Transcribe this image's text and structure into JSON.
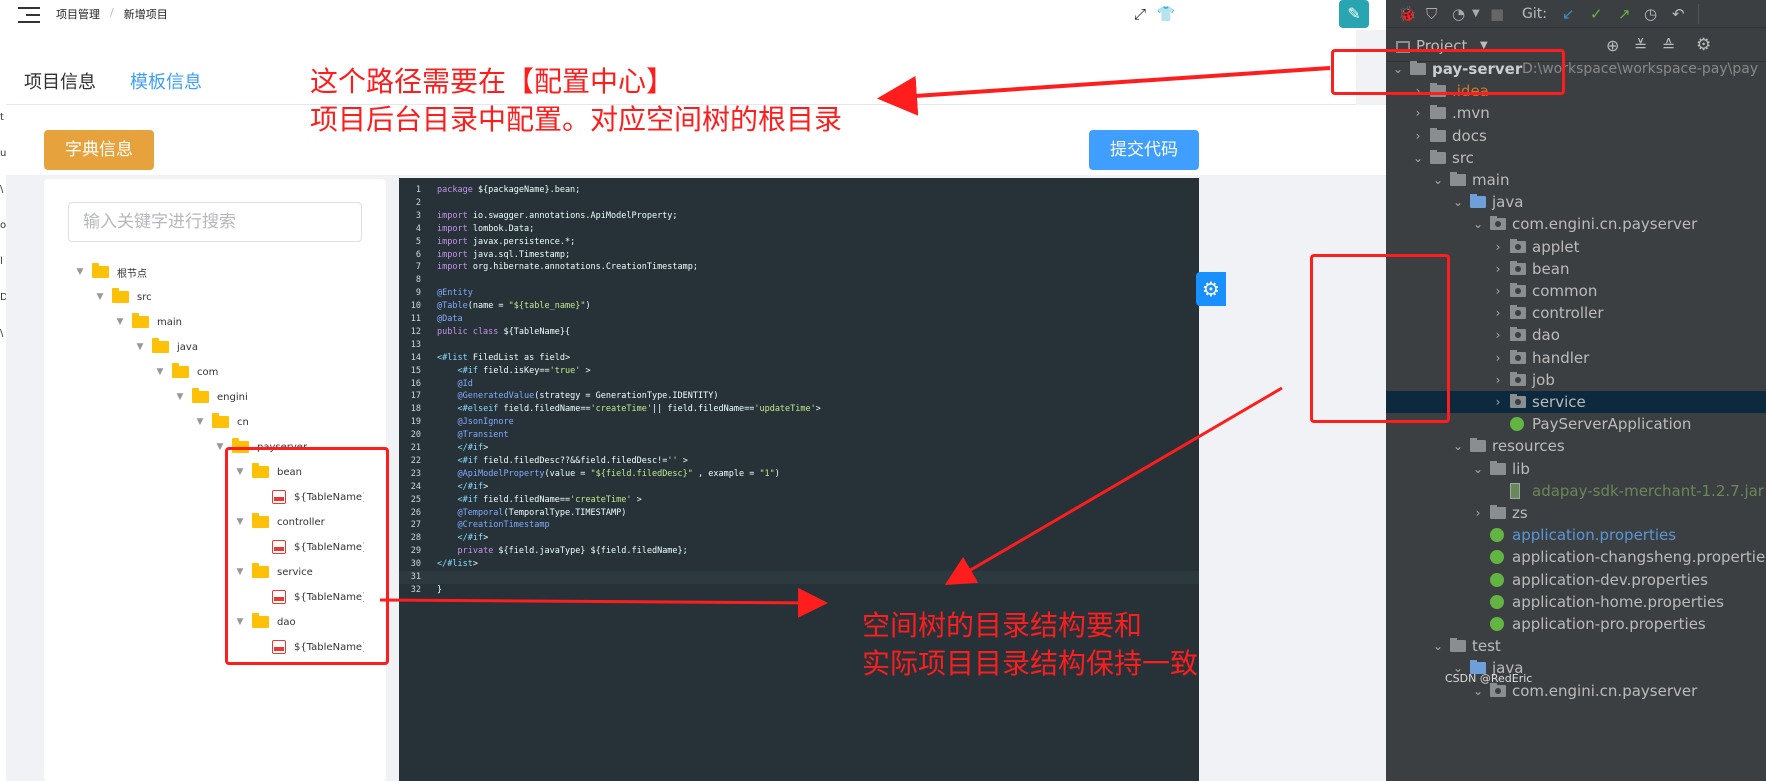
{
  "topbar": {
    "breadcrumb": [
      "项目管理",
      "新增项目"
    ],
    "breadcrumb_sep": "/",
    "icons": [
      "fullscreen-icon",
      "skin-icon",
      "avatar-icon"
    ]
  },
  "left_strip_chars": [
    "t",
    "u",
    "\\",
    "o",
    "l",
    "D",
    "\\"
  ],
  "tabs": [
    {
      "label": "项目信息",
      "active": false
    },
    {
      "label": "模板信息",
      "active": true
    }
  ],
  "buttons": {
    "dict": "字典信息",
    "submit": "提交代码"
  },
  "tree": {
    "search_placeholder": "输入关键字进行搜索",
    "nodes": [
      {
        "label": "根节点",
        "kind": "folder"
      },
      {
        "label": "src",
        "kind": "folder"
      },
      {
        "label": "main",
        "kind": "folder"
      },
      {
        "label": "java",
        "kind": "folder"
      },
      {
        "label": "com",
        "kind": "folder"
      },
      {
        "label": "engini",
        "kind": "folder"
      },
      {
        "label": "cn",
        "kind": "folder"
      },
      {
        "label": "payserver",
        "kind": "folder"
      },
      {
        "label": "bean",
        "kind": "folder"
      },
      {
        "label": "${TableName}.jav",
        "kind": "file"
      },
      {
        "label": "controller",
        "kind": "folder"
      },
      {
        "label": "${TableName}Co",
        "kind": "file"
      },
      {
        "label": "service",
        "kind": "folder"
      },
      {
        "label": "${TableName}Se",
        "kind": "file"
      },
      {
        "label": "dao",
        "kind": "folder"
      },
      {
        "label": "${TableName}Da",
        "kind": "file"
      }
    ]
  },
  "code_lines": [
    "package ${packageName}.bean;",
    "",
    "import io.swagger.annotations.ApiModelProperty;",
    "import lombok.Data;",
    "import javax.persistence.*;",
    "import java.sql.Timestamp;",
    "import org.hibernate.annotations.CreationTimestamp;",
    "",
    "@Entity",
    "@Table(name = \"${table_name}\")",
    "@Data",
    "public class ${TableName}{",
    "",
    "<#list FiledList as field>",
    "    <#if field.isKey=='true' >",
    "    @Id",
    "    @GeneratedValue(strategy = GenerationType.IDENTITY)",
    "    <#elseif field.filedName=='createTime'|| field.filedName=='updateTime'>",
    "    @JsonIgnore",
    "    @Transient",
    "    </#if>",
    "    <#if field.filedDesc??&&field.filedDesc!='' >",
    "    @ApiModelProperty(value = \"${field.filedDesc}\" , example = \"1\")",
    "    </#if>",
    "    <#if field.filedName=='createTime' >",
    "    @Temporal(TemporalType.TIMESTAMP)",
    "    @CreationTimestamp",
    "    </#if>",
    "    private ${field.javaType} ${field.filedName};",
    "</#list>",
    "",
    "}"
  ],
  "annotations": {
    "top_line1": "这个路径需要在【配置中心】",
    "top_line2": "项目后台目录中配置。对应空间树的根目录",
    "bottom_line1": "空间树的目录结构要和",
    "bottom_line2": "实际项目目录结构保持一致"
  },
  "ide": {
    "toolbar_git_label": "Git:",
    "panel_title": "Project",
    "rows": [
      {
        "label": "pay-server",
        "extra": "D:\\workspace\\workspace-pay\\pay",
        "icon": "folder",
        "chev": "v",
        "depth": 0,
        "style": "bold"
      },
      {
        "label": ".idea",
        "icon": "folder",
        "chev": ">",
        "depth": 1,
        "style": "orange"
      },
      {
        "label": ".mvn",
        "icon": "folder",
        "chev": ">",
        "depth": 1,
        "style": ""
      },
      {
        "label": "docs",
        "icon": "folder",
        "chev": ">",
        "depth": 1,
        "style": ""
      },
      {
        "label": "src",
        "icon": "folder",
        "chev": "v",
        "depth": 1,
        "style": ""
      },
      {
        "label": "main",
        "icon": "folder",
        "chev": "v",
        "depth": 2,
        "style": ""
      },
      {
        "label": "java",
        "icon": "folder-blue",
        "chev": "v",
        "depth": 3,
        "style": ""
      },
      {
        "label": "com.engini.cn.payserver",
        "icon": "package",
        "chev": "v",
        "depth": 4,
        "style": ""
      },
      {
        "label": "applet",
        "icon": "package",
        "chev": ">",
        "depth": 5,
        "style": ""
      },
      {
        "label": "bean",
        "icon": "package",
        "chev": ">",
        "depth": 5,
        "style": ""
      },
      {
        "label": "common",
        "icon": "package",
        "chev": ">",
        "depth": 5,
        "style": ""
      },
      {
        "label": "controller",
        "icon": "package",
        "chev": ">",
        "depth": 5,
        "style": ""
      },
      {
        "label": "dao",
        "icon": "package",
        "chev": ">",
        "depth": 5,
        "style": ""
      },
      {
        "label": "handler",
        "icon": "package",
        "chev": ">",
        "depth": 5,
        "style": ""
      },
      {
        "label": "job",
        "icon": "package",
        "chev": ">",
        "depth": 5,
        "style": ""
      },
      {
        "label": "service",
        "icon": "package",
        "chev": ">",
        "depth": 5,
        "style": "",
        "selected": true
      },
      {
        "label": "PayServerApplication",
        "icon": "spring",
        "chev": "",
        "depth": 5,
        "style": ""
      },
      {
        "label": "resources",
        "icon": "folder",
        "chev": "v",
        "depth": 3,
        "style": ""
      },
      {
        "label": "lib",
        "icon": "folder",
        "chev": "v",
        "depth": 4,
        "style": ""
      },
      {
        "label": "adapay-sdk-merchant-1.2.7.jar",
        "icon": "jar",
        "chev": "",
        "depth": 5,
        "style": "green"
      },
      {
        "label": "zs",
        "icon": "folder",
        "chev": ">",
        "depth": 4,
        "style": ""
      },
      {
        "label": "application.properties",
        "icon": "spring",
        "chev": "",
        "depth": 4,
        "style": "blue"
      },
      {
        "label": "application-changsheng.properties",
        "icon": "spring",
        "chev": "",
        "depth": 4,
        "style": ""
      },
      {
        "label": "application-dev.properties",
        "icon": "spring",
        "chev": "",
        "depth": 4,
        "style": ""
      },
      {
        "label": "application-home.properties",
        "icon": "spring",
        "chev": "",
        "depth": 4,
        "style": ""
      },
      {
        "label": "application-pro.properties",
        "icon": "spring",
        "chev": "",
        "depth": 4,
        "style": ""
      },
      {
        "label": "test",
        "icon": "folder",
        "chev": "v",
        "depth": 2,
        "style": ""
      },
      {
        "label": "java",
        "icon": "folder-blue",
        "chev": "v",
        "depth": 3,
        "style": ""
      },
      {
        "label": "com.engini.cn.payserver",
        "icon": "package",
        "chev": "v",
        "depth": 4,
        "style": ""
      }
    ],
    "watermark": "CSDN @RedEric"
  },
  "colors": {
    "accent": "#409eff",
    "warning": "#e6a23c",
    "annotation": "#ff1d1d",
    "ide_bg": "#3c3f41",
    "editor_bg": "#263238"
  }
}
